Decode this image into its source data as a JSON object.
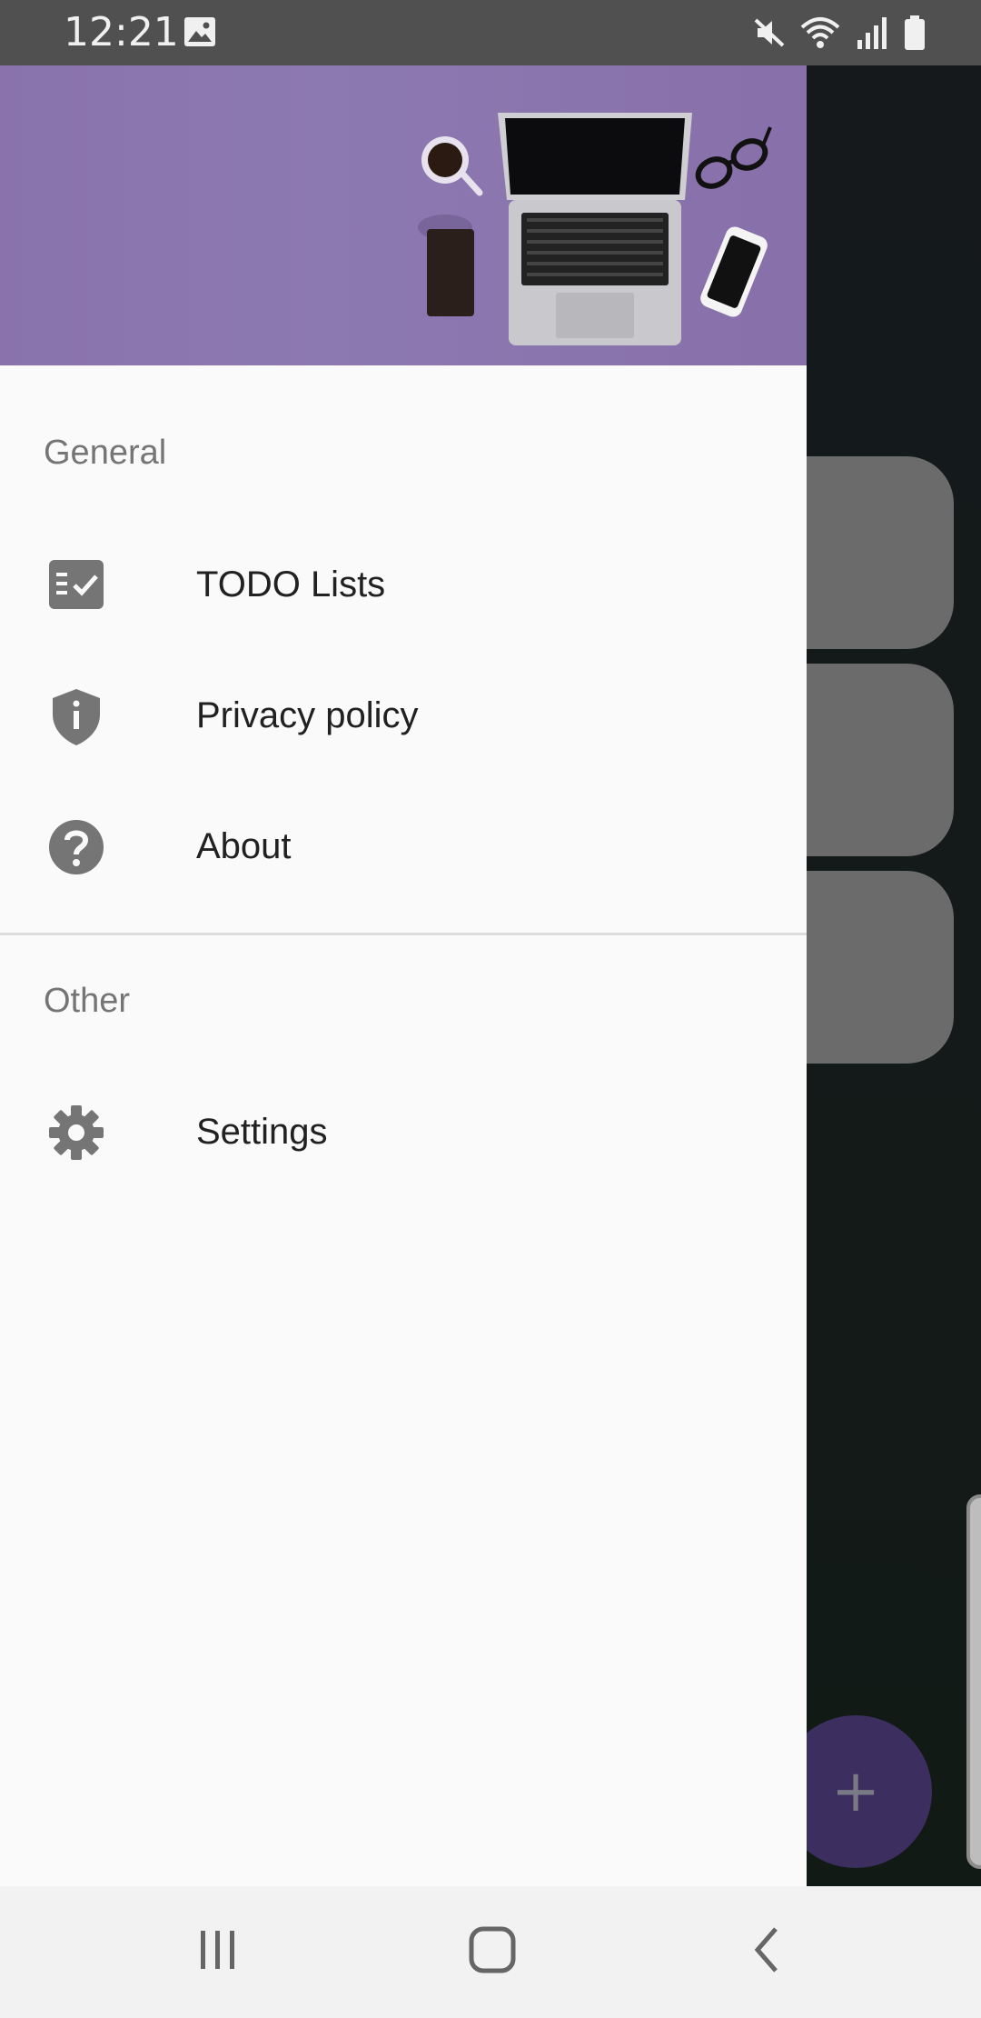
{
  "status_bar": {
    "time": "12:21",
    "icons": [
      "image-icon",
      "mute-icon",
      "wifi-icon",
      "signal-icon",
      "battery-icon"
    ]
  },
  "drawer": {
    "header_image": "desk-with-laptop-illustration",
    "sections": [
      {
        "title": "General",
        "items": [
          {
            "label": "TODO Lists",
            "icon": "checklist-icon"
          },
          {
            "label": "Privacy policy",
            "icon": "shield-info-icon"
          },
          {
            "label": "About",
            "icon": "help-circle-icon"
          }
        ]
      },
      {
        "title": "Other",
        "items": [
          {
            "label": "Settings",
            "icon": "gear-icon"
          }
        ]
      }
    ]
  },
  "background": {
    "fab_label": "+"
  },
  "nav_bar": {
    "buttons": [
      "recents-button",
      "home-button",
      "back-button"
    ]
  },
  "colors": {
    "header_purple": "#8a73ad",
    "drawer_bg": "#fafafa",
    "icon_gray": "#757575",
    "text_primary": "#212121",
    "section_gray": "#757575"
  }
}
